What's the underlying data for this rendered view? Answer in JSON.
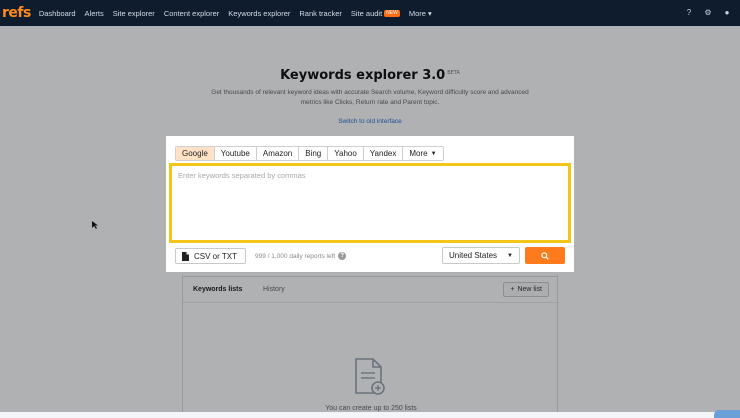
{
  "navbar": {
    "logo": "refs",
    "items": [
      {
        "label": "Dashboard"
      },
      {
        "label": "Alerts"
      },
      {
        "label": "Site explorer"
      },
      {
        "label": "Content explorer"
      },
      {
        "label": "Keywords explorer"
      },
      {
        "label": "Rank tracker"
      },
      {
        "label": "Site audit",
        "badge": "NEW"
      },
      {
        "label": "More"
      }
    ]
  },
  "hero": {
    "title": "Keywords explorer 3.0",
    "title_badge": "BETA",
    "description": "Get thousands of relevant keyword ideas with accurate Search volume, Keyword difficulty score and advanced metrics like Clicks, Return rate and Parent topic.",
    "switch_link": "Switch to old interface"
  },
  "lists": {
    "tab_active": "Keywords lists",
    "tab_inactive": "History",
    "new_list_label": "New list",
    "empty_note": "You can create up to 250 lists"
  },
  "modal": {
    "engines": [
      {
        "label": "Google",
        "active": true
      },
      {
        "label": "Youtube"
      },
      {
        "label": "Amazon"
      },
      {
        "label": "Bing"
      },
      {
        "label": "Yahoo"
      },
      {
        "label": "Yandex"
      },
      {
        "label": "More",
        "dropdown": true
      }
    ],
    "input_placeholder": "Enter keywords separated by commas",
    "input_value": "",
    "csv_label": "CSV or TXT",
    "reports_text": "999 / 1,000 daily reports left",
    "country_selected": "United States",
    "colors": {
      "highlight": "#f2c517",
      "accent": "#ff7a1a",
      "active_tab": "#ffe2c6"
    }
  }
}
